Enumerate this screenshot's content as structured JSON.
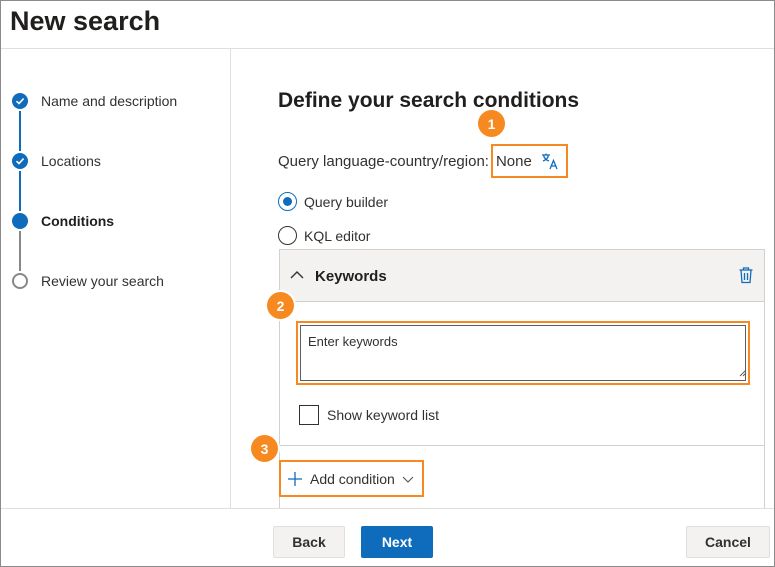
{
  "page": {
    "title": "New search"
  },
  "steps": [
    {
      "label": "Name and description",
      "state": "done",
      "icon": "checkmark-icon"
    },
    {
      "label": "Locations",
      "state": "done",
      "icon": "checkmark-icon"
    },
    {
      "label": "Conditions",
      "state": "current"
    },
    {
      "label": "Review your search",
      "state": "pending"
    }
  ],
  "main": {
    "heading": "Define your search conditions",
    "query_language_label": "Query language-country/region:",
    "query_language_value": "None",
    "query_language_icon": "language-translate-icon",
    "radios": [
      {
        "label": "Query builder",
        "checked": true
      },
      {
        "label": "KQL editor",
        "checked": false
      }
    ],
    "keywords_panel": {
      "title": "Keywords",
      "collapse_icon": "chevron-up-icon",
      "delete_icon": "trash-icon",
      "input_placeholder": "Enter keywords",
      "show_list_label": "Show keyword list",
      "show_list_checked": false
    },
    "add_condition_label": "Add condition",
    "add_condition_icons": [
      "plus-icon",
      "chevron-down-icon"
    ]
  },
  "callouts": [
    "1",
    "2",
    "3"
  ],
  "footer": {
    "back": "Back",
    "next": "Next",
    "cancel": "Cancel"
  },
  "colors": {
    "accent": "#0f6cbd",
    "callout": "#f6891f",
    "neutral_bg": "#f3f2f1"
  }
}
